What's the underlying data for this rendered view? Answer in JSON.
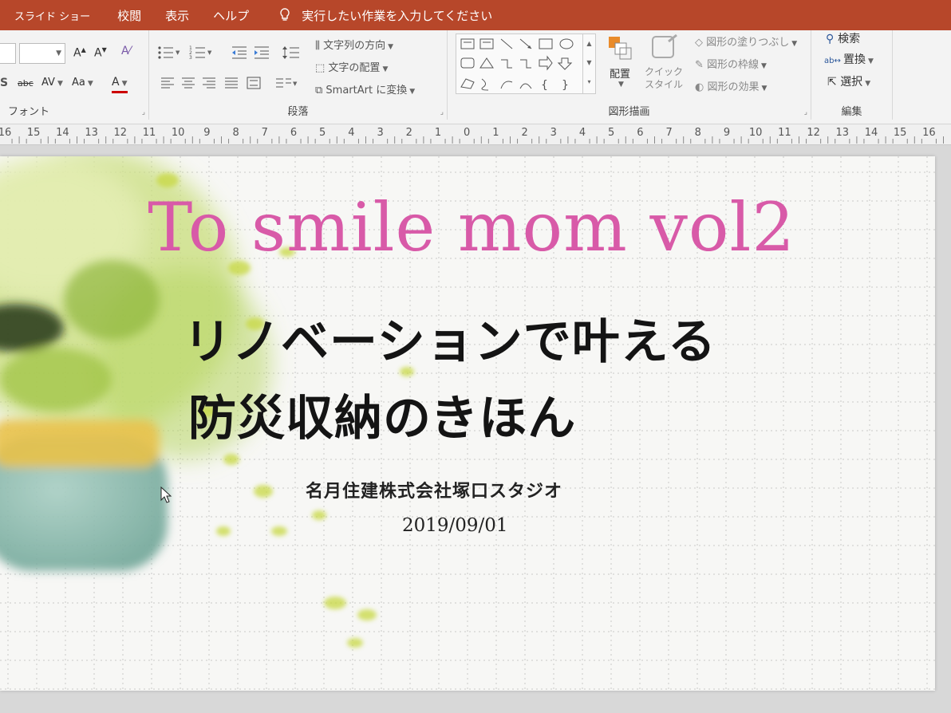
{
  "menubar": {
    "items": [
      "スライド ショー",
      "校閲",
      "表示",
      "ヘルプ"
    ],
    "tell_me": "実行したい作業を入力してください",
    "color": "#b7472a"
  },
  "ribbon": {
    "font": {
      "label": "フォント"
    },
    "paragraph": {
      "label": "段落",
      "text_direction": "文字列の方向",
      "align_text": "文字の配置",
      "smartart": "SmartArt に変換"
    },
    "drawing": {
      "label": "図形描画",
      "arrange": "配置",
      "quick_styles": "クイック\nスタイル",
      "shape_fill": "図形の塗りつぶし",
      "shape_outline": "図形の枠線",
      "shape_effects": "図形の効果"
    },
    "editing": {
      "label": "編集",
      "find": "検索",
      "replace": "置換",
      "select": "選択"
    }
  },
  "ruler": {
    "labels": [
      "16",
      "15",
      "14",
      "13",
      "12",
      "11",
      "10",
      "9",
      "8",
      "7",
      "6",
      "5",
      "4",
      "3",
      "2",
      "1",
      "0",
      "1",
      "2",
      "3",
      "4",
      "5",
      "6",
      "7",
      "8",
      "9",
      "10",
      "11",
      "12",
      "13",
      "14",
      "15",
      "16"
    ]
  },
  "slide": {
    "title": "To smile mom vol2",
    "subtitle_line1": "リノベーションで叶える",
    "subtitle_line2": "防災収納のきほん",
    "company": "名月住建株式会社塚口スタジオ",
    "date": "2019/09/01",
    "title_color": "#d85aa8"
  }
}
